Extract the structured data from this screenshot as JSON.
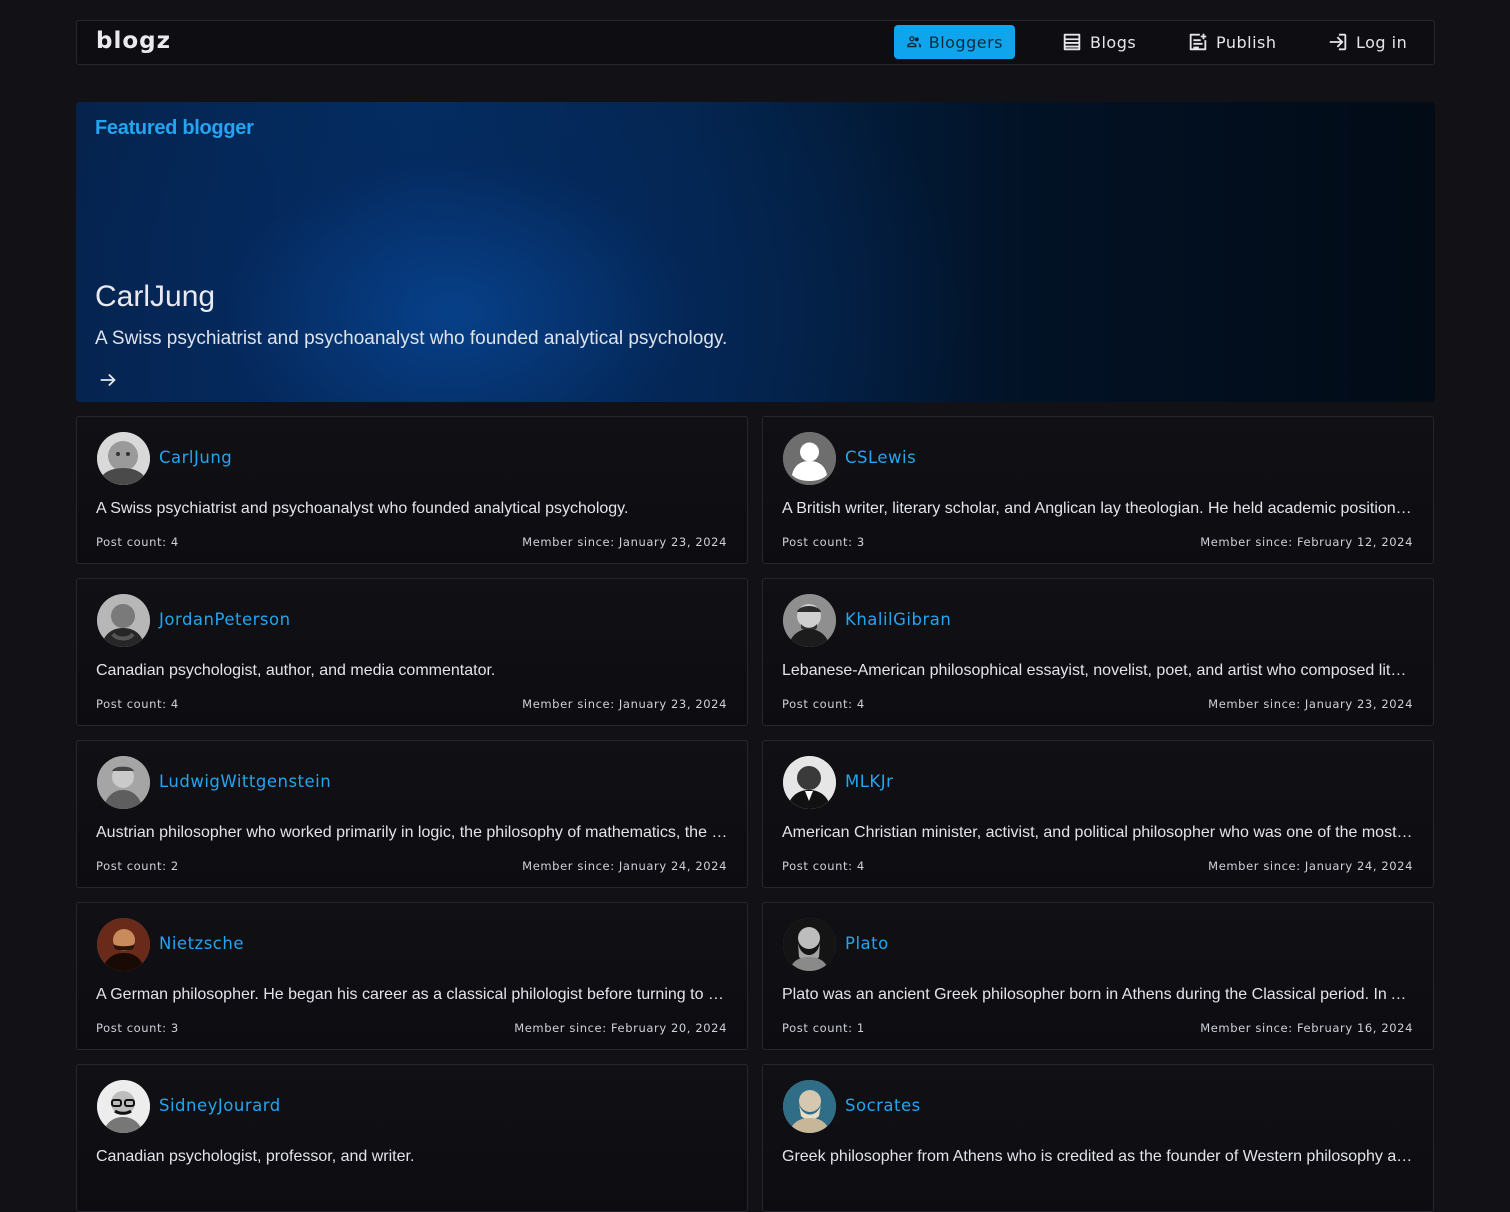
{
  "navbar": {
    "brand": "blogz",
    "items": [
      {
        "label": "Bloggers",
        "icon": "users-icon",
        "active": true
      },
      {
        "label": "Blogs",
        "icon": "blog-list-icon",
        "active": false
      },
      {
        "label": "Publish",
        "icon": "publish-icon",
        "active": false
      },
      {
        "label": "Log in",
        "icon": "login-icon",
        "active": false
      }
    ]
  },
  "featured": {
    "label": "Featured blogger",
    "name": "CarlJung",
    "description": "A Swiss psychiatrist and psychoanalyst who founded analytical psychology.",
    "arrow_icon": "arrow-right-icon"
  },
  "bloggers": [
    {
      "name": "CarlJung",
      "description": "A Swiss psychiatrist and psychoanalyst who founded analytical psychology.",
      "post_count": "Post count: 4",
      "member_since": "Member since: January 23, 2024"
    },
    {
      "name": "CSLewis",
      "description": "A British writer, literary scholar, and Anglican lay theologian. He held academic positions in English literature at both Oxford University and Cambridge University.",
      "post_count": "Post count: 3",
      "member_since": "Member since: February 12, 2024"
    },
    {
      "name": "JordanPeterson",
      "description": "Canadian psychologist, author, and media commentator.",
      "post_count": "Post count: 4",
      "member_since": "Member since: January 23, 2024"
    },
    {
      "name": "KhalilGibran",
      "description": "Lebanese-American philosophical essayist, novelist, poet, and artist who composed literature in both Arabic and English.",
      "post_count": "Post count: 4",
      "member_since": "Member since: January 23, 2024"
    },
    {
      "name": "LudwigWittgenstein",
      "description": "Austrian philosopher who worked primarily in logic, the philosophy of mathematics, the philosophy of mind, and the philosophy of language.",
      "post_count": "Post count: 2",
      "member_since": "Member since: January 24, 2024"
    },
    {
      "name": "MLKJr",
      "description": "American Christian minister, activist, and political philosopher who was one of the most prominent leaders in the civil rights movement.",
      "post_count": "Post count: 4",
      "member_since": "Member since: January 24, 2024"
    },
    {
      "name": "Nietzsche",
      "description": "A German philosopher. He began his career as a classical philologist before turning to philosophy.",
      "post_count": "Post count: 3",
      "member_since": "Member since: February 20, 2024"
    },
    {
      "name": "Plato",
      "description": "Plato was an ancient Greek philosopher born in Athens during the Classical period. In Athens, Plato founded the Academy.",
      "post_count": "Post count: 1",
      "member_since": "Member since: February 16, 2024"
    },
    {
      "name": "SidneyJourard",
      "description": "Canadian psychologist, professor, and writer.",
      "post_count": "",
      "member_since": ""
    },
    {
      "name": "Socrates",
      "description": "Greek philosopher from Athens who is credited as the founder of Western philosophy and among the first moral philosophers.",
      "post_count": "",
      "member_since": ""
    }
  ]
}
